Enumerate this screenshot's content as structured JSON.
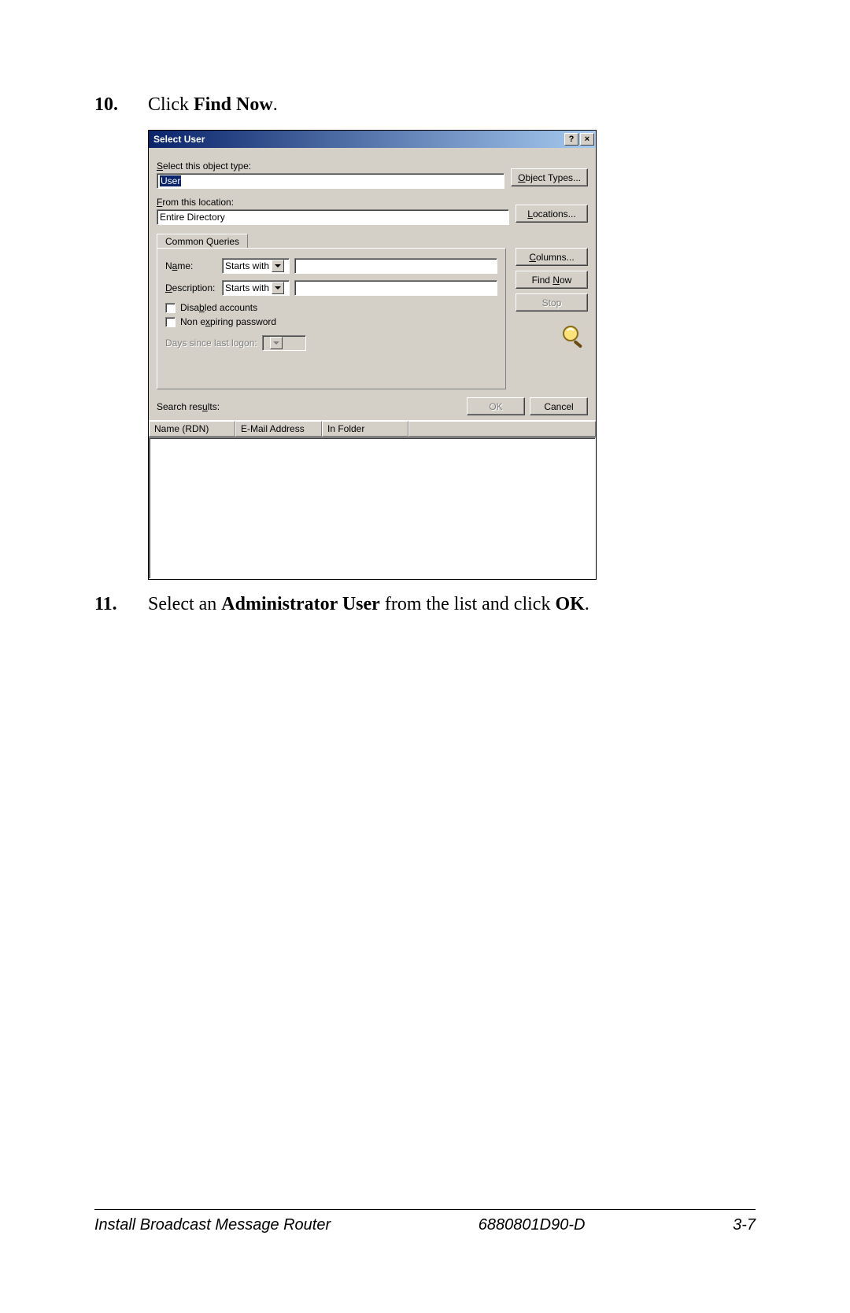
{
  "steps": {
    "s10": {
      "num": "10.",
      "prefix": "Click ",
      "bold": "Find Now",
      "suffix": "."
    },
    "s11": {
      "num": "11.",
      "prefix": "Select an ",
      "bold1": "Administrator User",
      "mid": " from the list and click ",
      "bold2": "OK",
      "suffix": "."
    }
  },
  "dialog": {
    "title": "Select User",
    "help_glyph": "?",
    "close_glyph": "×",
    "select_type_label": "Select this object type:",
    "select_type_label_u": "S",
    "object_type_value": "User",
    "object_types_btn": "Object Types...",
    "object_types_btn_u": "O",
    "from_location_label": "From this location:",
    "from_location_label_u": "F",
    "location_value": "Entire Directory",
    "locations_btn": "Locations...",
    "locations_btn_u": "L",
    "tab_label": "Common Queries",
    "name_label": "Name:",
    "name_label_u": "A",
    "starts_with": "Starts with",
    "desc_label": "Description:",
    "desc_label_u": "D",
    "disabled_cb": "Disabled accounts",
    "disabled_cb_u": "b",
    "nonexp_cb": "Non expiring password",
    "nonexp_cb_u": "x",
    "days_label": "Days since last logon:",
    "columns_btn": "Columns...",
    "columns_btn_u": "C",
    "findnow_btn": "Find Now",
    "findnow_btn_u": "N",
    "stop_btn": "Stop",
    "ok_btn": "OK",
    "cancel_btn": "Cancel",
    "search_results_label": "Search results:",
    "search_results_label_u": "u",
    "col1": "Name (RDN)",
    "col2": "E-Mail Address",
    "col3": "In Folder"
  },
  "footer": {
    "left": "Install Broadcast Message Router",
    "center": "6880801D90-D",
    "right": "3-7"
  }
}
